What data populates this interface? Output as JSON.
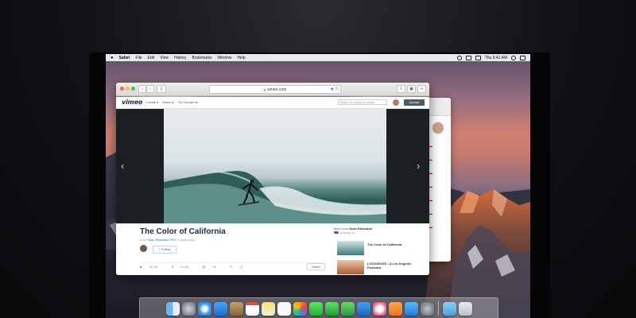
{
  "menubar": {
    "apple": "",
    "items": [
      "Safari",
      "File",
      "Edit",
      "View",
      "History",
      "Bookmarks",
      "Window",
      "Help"
    ],
    "clock": "Thu 9:41 AM"
  },
  "browser": {
    "address": "vimeo.com"
  },
  "vimeo": {
    "logo": "vimeo",
    "nav": [
      "Create ▾",
      "Watch ▾",
      "On Demand ▾"
    ],
    "search_placeholder": "Search for videos or people",
    "upload": "Upload",
    "video_title": "The Color of California",
    "byline_from": "from",
    "byline_author": "Sean Stoksdon",
    "byline_badge": "PRO",
    "byline_time": "2 weeks ago",
    "follow": "+ Follow",
    "stats": [
      "85.3K",
      "5,183",
      "98",
      "11"
    ],
    "share": "Share",
    "more_from_label": "More from",
    "more_from_author": "Sean Stoksdon",
    "autoplay": "Autoplay on",
    "related": [
      {
        "title": "The Color of California"
      },
      {
        "title": "LOCKWOOD • A Los Angeles Postcard"
      }
    ]
  },
  "colors": {
    "vimeo_navy": "#1a2e3b",
    "link_blue": "#1a6fb5",
    "close": "#fc605c",
    "minimize": "#fdbc40",
    "zoom": "#34c84a"
  },
  "dock_icons": [
    "finder-icon",
    "launchpad-icon",
    "safari-icon",
    "mail-icon",
    "contacts-icon",
    "calendar-icon",
    "notes-icon",
    "reminders-icon",
    "photos-icon",
    "messages-icon",
    "facetime-icon",
    "numbers-icon",
    "keynote-icon",
    "itunes-icon",
    "ibooks-icon",
    "appstore-icon",
    "system-preferences-icon",
    "downloads-folder-icon",
    "trash-icon"
  ]
}
